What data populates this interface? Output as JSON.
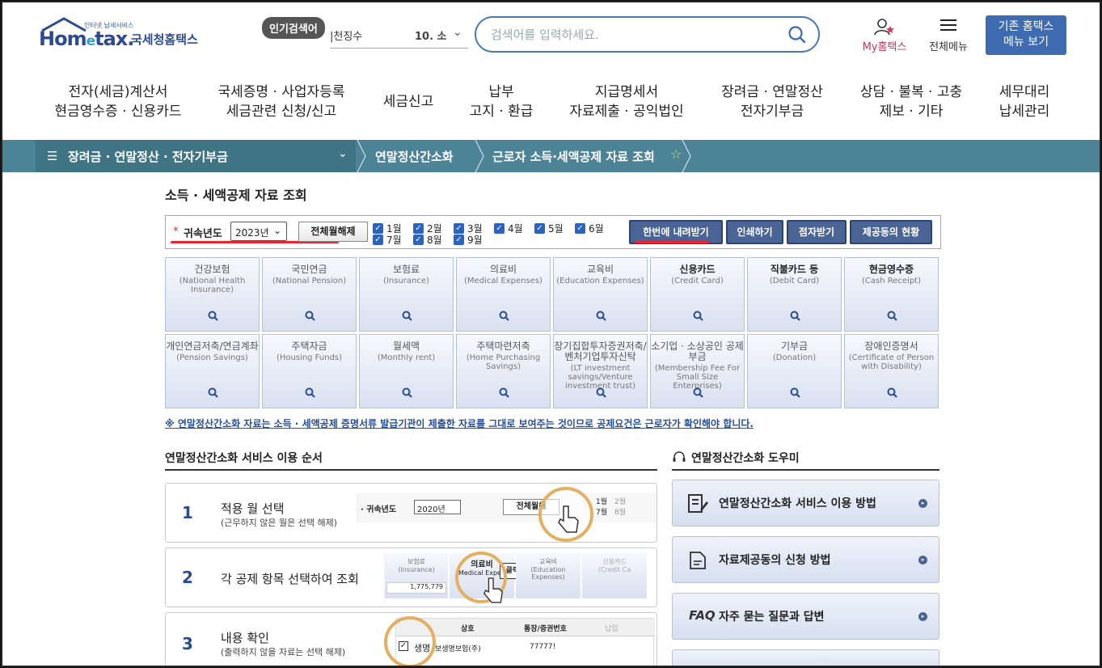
{
  "header": {
    "logo_small": "인터넷 납세서비스",
    "logo_brand_a": "Hom",
    "logo_brand_e": "e",
    "logo_brand_b": "tax.",
    "logo_kr": "국세청홈택스",
    "popular_badge": "인기검색어",
    "ticker_text": "|천징수",
    "ticker_rank": "10. 소",
    "search_placeholder": "검색어를 입력하세요.",
    "my_hometax": "My홈택스",
    "all_menu": "전체메뉴",
    "old_menu_line1": "기존 홈택스",
    "old_menu_line2": "메뉴 보기"
  },
  "gnb": [
    {
      "l1": "전자(세금)계산서",
      "l2": "현금영수증 · 신용카드"
    },
    {
      "l1": "국세증명 · 사업자등록",
      "l2": "세금관련 신청/신고"
    },
    {
      "l1": "세금신고",
      "l2": ""
    },
    {
      "l1": "납부",
      "l2": "고지 · 환급"
    },
    {
      "l1": "지급명세서",
      "l2": "자료제출 · 공익법인"
    },
    {
      "l1": "장려금 · 연말정산",
      "l2": "전자기부금"
    },
    {
      "l1": "상담 · 불복 · 고충",
      "l2": "제보 · 기타"
    },
    {
      "l1": "세무대리",
      "l2": "납세관리"
    }
  ],
  "location": {
    "menu": "장려금 · 연말정산 · 전자기부금",
    "sub": "연말정산간소화",
    "current": "근로자 소득·세액공제 자료 조회"
  },
  "page_title": "소득 · 세액공제 자료 조회",
  "filter": {
    "required_mark": "*",
    "year_label": "귀속년도",
    "year_value": "2023년",
    "deselect_all": "전체월해제",
    "months": [
      "1월",
      "2월",
      "3월",
      "4월",
      "5월",
      "6월",
      "7월",
      "8월",
      "9월"
    ],
    "buttons": [
      "한번에 내려받기",
      "인쇄하기",
      "점자받기",
      "제공동의 현황"
    ]
  },
  "categories": [
    {
      "k": "건강보험",
      "e": "(National Health Insurance)",
      "dark": false
    },
    {
      "k": "국민연금",
      "e": "(National Pension)",
      "dark": false
    },
    {
      "k": "보험료",
      "e": "(Insurance)",
      "dark": false
    },
    {
      "k": "의료비",
      "e": "(Medical Expenses)",
      "dark": false
    },
    {
      "k": "교육비",
      "e": "(Education Expenses)",
      "dark": false
    },
    {
      "k": "신용카드",
      "e": "(Credit Card)",
      "dark": true
    },
    {
      "k": "직불카드 등",
      "e": "(Debit Card)",
      "dark": true
    },
    {
      "k": "현금영수증",
      "e": "(Cash Receipt)",
      "dark": true
    },
    {
      "k": "개인연금저축/연금계좌",
      "e": "(Pension Savings)",
      "dark": false
    },
    {
      "k": "주택자금",
      "e": "(Housing Funds)",
      "dark": false
    },
    {
      "k": "월세액",
      "e": "(Monthly rent)",
      "dark": false
    },
    {
      "k": "주택마련저축",
      "e": "(Home Purchasing Savings)",
      "dark": false
    },
    {
      "k": "장기집합투자증권저축/벤처기업투자신탁",
      "e": "(LT investment savings/Venture investment trust)",
      "dark": false
    },
    {
      "k": "소기업 · 소상공인 공제부금",
      "e": "(Membership Fee For Small Size Enterprises)",
      "dark": false
    },
    {
      "k": "기부금",
      "e": "(Donation)",
      "dark": false
    },
    {
      "k": "장애인증명서",
      "e": "(Certificate of Person with Disability)",
      "dark": false
    }
  ],
  "notice": "※ 연말정산간소화 자료는 소득 · 세액공제 증명서류 발급기관이 제출한 자료를 그대로 보여주는 것이므로 공제요건은 근로자가 확인해야 합니다.",
  "service_title": "연말정산간소화 서비스 이용 순서",
  "steps": [
    {
      "num": "1",
      "title": "적용 월 선택",
      "sub": "(근무하지 않은 월은 선택 해제)"
    },
    {
      "num": "2",
      "title": "각 공제 항목 선택하여 조회",
      "sub": ""
    },
    {
      "num": "3",
      "title": "내용 확인",
      "sub": "(출력하지 않을 자료는 선택 해제)"
    }
  ],
  "step_previews": {
    "s1_label": "· 귀속년도",
    "s1_year": "2020년",
    "s1_btn": "전체월해",
    "s1_m1": "1월",
    "s1_m7": "7월",
    "s1_m2": "2월",
    "s1_m8": "8월",
    "s2_c1": "보험료",
    "s2_c1e": "(Insurance)",
    "s2_amount": "1,775,779",
    "s2_c2": "의료비",
    "s2_c2e": "Medical Expen",
    "s2_click": "클릭!",
    "s2_c3": "교육비",
    "s2_c3e": "(Education Expenses)",
    "s2_c4": "신용카드",
    "s2_c4e": "(Credit Ca",
    "s3_col1": "상호",
    "s3_col2": "통장/증권번호",
    "s3_col3": "납입",
    "s3_row_name": "생명",
    "s3_row_co": "보생명보험(주)",
    "s3_row_no": "77777!"
  },
  "helper_title": "연말정산간소화 도우미",
  "helpers": [
    {
      "icon": "document-pen-icon",
      "label": "연말정산간소화 서비스 이용 방법"
    },
    {
      "icon": "document-icon",
      "label": "자료제공동의 신청 방법"
    },
    {
      "icon": "faq-icon",
      "label": "자주 묻는 질문과 답변",
      "prefix": "FAQ"
    }
  ],
  "colors": {
    "brand": "#2b4c94",
    "locbar": "#4d8396",
    "button": "#4a6496",
    "accent_red": "#e22233"
  }
}
